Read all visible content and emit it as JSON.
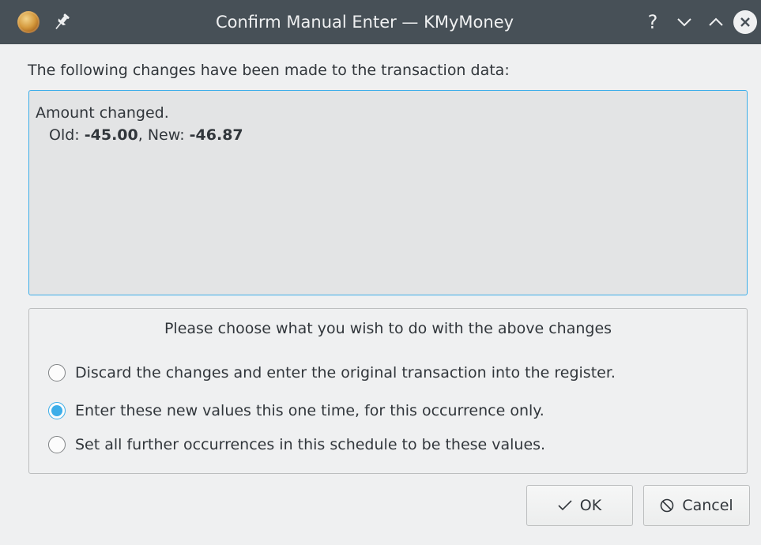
{
  "window": {
    "title": "Confirm Manual Enter — KMyMoney",
    "help_label": "?"
  },
  "dialog": {
    "heading": "The following changes have been made to the transaction data:",
    "changes": {
      "line1": "Amount changed.",
      "old_label": "Old: ",
      "old_value": "-45.00",
      "separator": ", New: ",
      "new_value": "-46.87"
    },
    "choice_group": {
      "title": "Please choose what you wish to do with the above changes",
      "options": [
        {
          "label": "Discard the changes and enter the original transaction into the register.",
          "checked": false
        },
        {
          "label": "Enter these new values this one time, for this occurrence only.",
          "checked": true
        },
        {
          "label": "Set all further occurrences in this schedule to be these values.",
          "checked": false
        }
      ]
    },
    "buttons": {
      "ok_label": "OK",
      "cancel_label": "Cancel"
    }
  },
  "icons": {
    "app": "kmymoney-icon",
    "pin": "pin-icon",
    "minimize": "chevron-down-icon",
    "maximize": "chevron-up-icon",
    "close": "close-icon",
    "ok": "checkmark-icon",
    "cancel": "cancel-icon"
  },
  "colors": {
    "titlebar": "#475057",
    "accent": "#3daee9",
    "window_bg": "#eff0f1",
    "text": "#31363b"
  }
}
